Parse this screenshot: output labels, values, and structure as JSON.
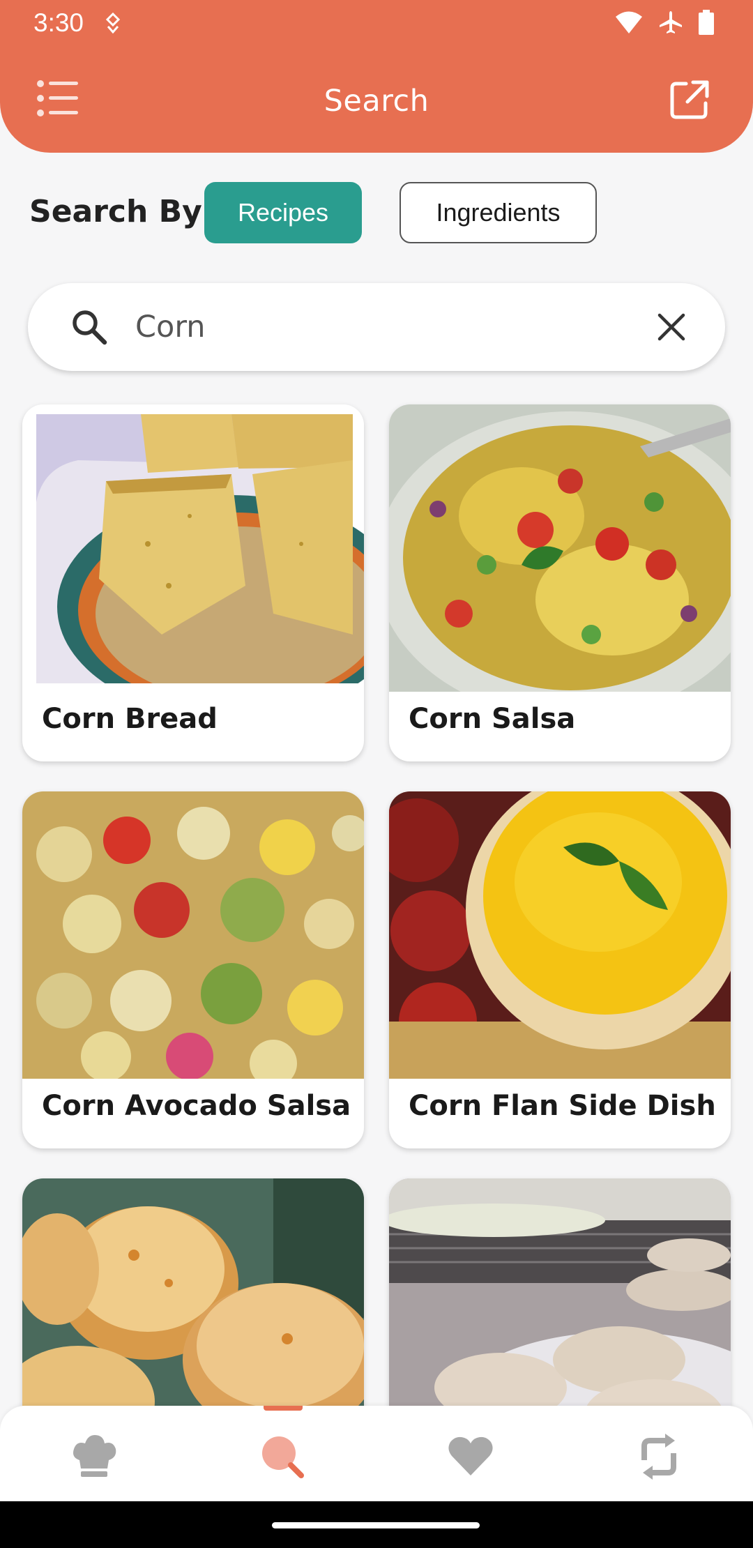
{
  "status_bar": {
    "time": "3:30"
  },
  "header": {
    "title": "Search"
  },
  "search_by": {
    "label": "Search By:",
    "options": [
      {
        "label": "Recipes",
        "selected": true
      },
      {
        "label": "Ingredients",
        "selected": false
      }
    ]
  },
  "search": {
    "value": "Corn"
  },
  "recipes": [
    {
      "title": "Corn Bread"
    },
    {
      "title": "Corn Salsa"
    },
    {
      "title": "Corn Avocado Salsa"
    },
    {
      "title": "Corn Flan Side Dish"
    },
    {
      "title": ""
    },
    {
      "title": ""
    }
  ],
  "bottom_nav": {
    "items": [
      {
        "icon": "chef-hat-icon",
        "active": false
      },
      {
        "icon": "search-icon",
        "active": true
      },
      {
        "icon": "heart-icon",
        "active": false
      },
      {
        "icon": "refresh-icon",
        "active": false
      }
    ]
  },
  "colors": {
    "accent": "#e76f51",
    "selected_tab": "#2a9d8f",
    "background": "#f6f6f7"
  }
}
